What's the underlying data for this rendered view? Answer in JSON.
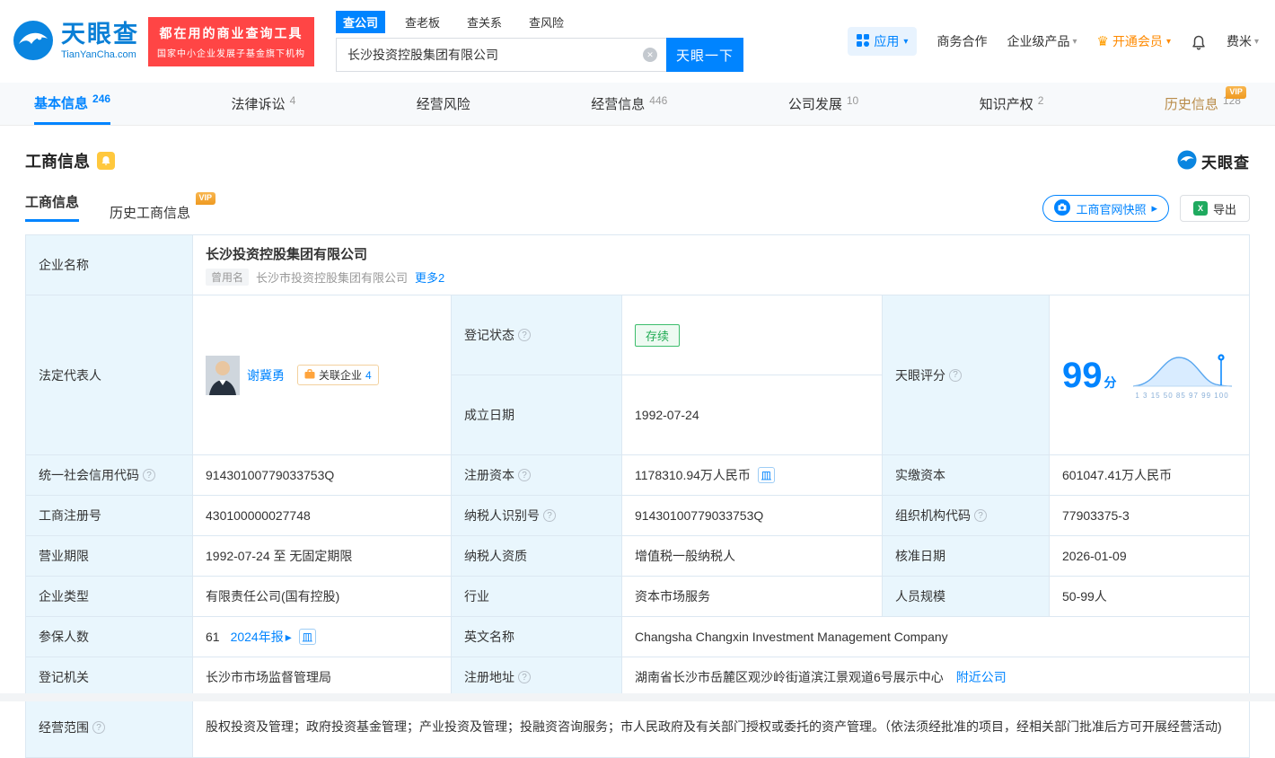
{
  "brand": {
    "cn": "天眼查",
    "en": "TianYanCha.com"
  },
  "header": {
    "promo_line1": "都在用的商业查询工具",
    "promo_line2": "国家中小企业发展子基金旗下机构",
    "search_tabs": [
      {
        "label": "查公司"
      },
      {
        "label": "查老板"
      },
      {
        "label": "查关系"
      },
      {
        "label": "查风险"
      }
    ],
    "search_value": "长沙投资控股集团有限公司",
    "search_button": "天眼一下",
    "menu": {
      "apps": "应用",
      "cooperation": "商务合作",
      "enterprise": "企业级产品",
      "vip": "开通会员",
      "user": "费米"
    }
  },
  "nav": {
    "items": [
      {
        "label": "基本信息",
        "count": "246"
      },
      {
        "label": "法律诉讼",
        "count": "4"
      },
      {
        "label": "经营风险",
        "count": ""
      },
      {
        "label": "经营信息",
        "count": "446"
      },
      {
        "label": "公司发展",
        "count": "10"
      },
      {
        "label": "知识产权",
        "count": "2"
      },
      {
        "label": "历史信息",
        "count": "128",
        "vip": "VIP"
      }
    ]
  },
  "section": {
    "title": "工商信息",
    "brand": "天眼查",
    "subtabs": [
      {
        "label": "工商信息"
      },
      {
        "label": "历史工商信息",
        "vip": "VIP"
      }
    ],
    "snapshot_button": "工商官网快照",
    "export_button": "导出"
  },
  "info": {
    "company_name": {
      "label": "企业名称",
      "value": "长沙投资控股集团有限公司"
    },
    "former_name": {
      "tag": "曾用名",
      "value": "长沙市投资控股集团有限公司",
      "more": "更多2"
    },
    "legal_rep": {
      "label": "法定代表人",
      "name": "谢冀勇",
      "related_label": "关联企业",
      "related_count": "4"
    },
    "reg_status": {
      "label": "登记状态",
      "value": "存续"
    },
    "est_date": {
      "label": "成立日期",
      "value": "1992-07-24"
    },
    "score": {
      "label": "天眼评分",
      "value": "99",
      "unit": "分",
      "ticks": "1 3 15 50 85 97 99 100"
    },
    "credit_code": {
      "label": "统一社会信用代码",
      "value": "91430100779033753Q"
    },
    "reg_capital": {
      "label": "注册资本",
      "value": "1178310.94万人民币"
    },
    "paid_capital": {
      "label": "实缴资本",
      "value": "601047.41万人民币"
    },
    "reg_no": {
      "label": "工商注册号",
      "value": "430100000027748"
    },
    "tax_id": {
      "label": "纳税人识别号",
      "value": "91430100779033753Q"
    },
    "org_code": {
      "label": "组织机构代码",
      "value": "77903375-3"
    },
    "term": {
      "label": "营业期限",
      "value": "1992-07-24 至 无固定期限"
    },
    "tax_quality": {
      "label": "纳税人资质",
      "value": "增值税一般纳税人"
    },
    "approval_date": {
      "label": "核准日期",
      "value": "2026-01-09"
    },
    "company_type": {
      "label": "企业类型",
      "value": "有限责任公司(国有控股)"
    },
    "industry": {
      "label": "行业",
      "value": "资本市场服务"
    },
    "staff_size": {
      "label": "人员规模",
      "value": "50-99人"
    },
    "insured": {
      "label": "参保人数",
      "value": "61",
      "report": "2024年报"
    },
    "english_name": {
      "label": "英文名称",
      "value": "Changsha Changxin Investment Management Company"
    },
    "authority": {
      "label": "登记机关",
      "value": "长沙市市场监督管理局"
    },
    "address": {
      "label": "注册地址",
      "value": "湖南省长沙市岳麓区观沙岭街道滨江景观道6号展示中心",
      "nearby": "附近公司"
    },
    "scope": {
      "label": "经营范围",
      "value": "股权投资及管理；政府投资基金管理；产业投资及管理；投融资咨询服务；市人民政府及有关部门授权或委托的资产管理。（依法须经批准的项目，经相关部门批准后方可开展经营活动)"
    }
  },
  "colors": {
    "primary_blue": "#0084ff",
    "promo_red": "#ff4545",
    "vip_gold": "#ef9a21",
    "status_green": "#22ab54",
    "label_bg": "#e9f6fd"
  }
}
